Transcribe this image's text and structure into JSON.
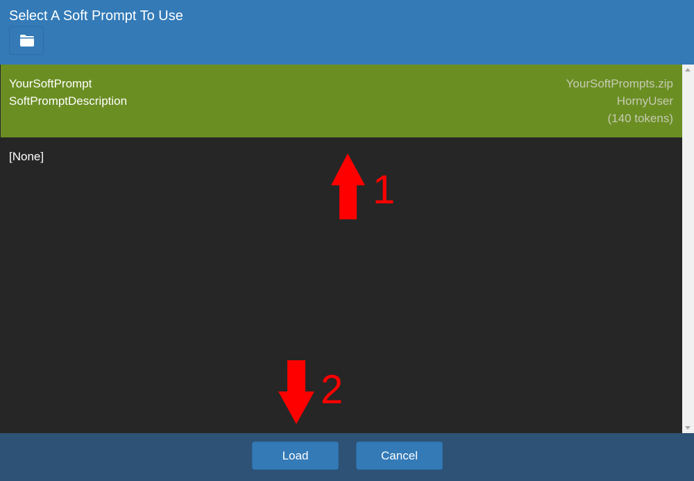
{
  "header": {
    "title": "Select A Soft Prompt To Use",
    "folder_icon": "folder-icon"
  },
  "list": {
    "selected_item": {
      "name": "YourSoftPrompt",
      "description": "SoftPromptDescription",
      "file": "YourSoftPrompts.zip",
      "author": "HornyUser",
      "tokens": "(140 tokens)"
    },
    "none_item": {
      "label": "[None]"
    }
  },
  "annotations": {
    "arrow_up_label": "1",
    "arrow_down_label": "2",
    "color": "#ff0000"
  },
  "footer": {
    "load_label": "Load",
    "cancel_label": "Cancel"
  },
  "colors": {
    "header_bg": "#337ab7",
    "selected_bg": "#6b8e23",
    "list_bg": "#262626",
    "footer_bg": "#2d5275",
    "button_bg": "#337ab7"
  }
}
